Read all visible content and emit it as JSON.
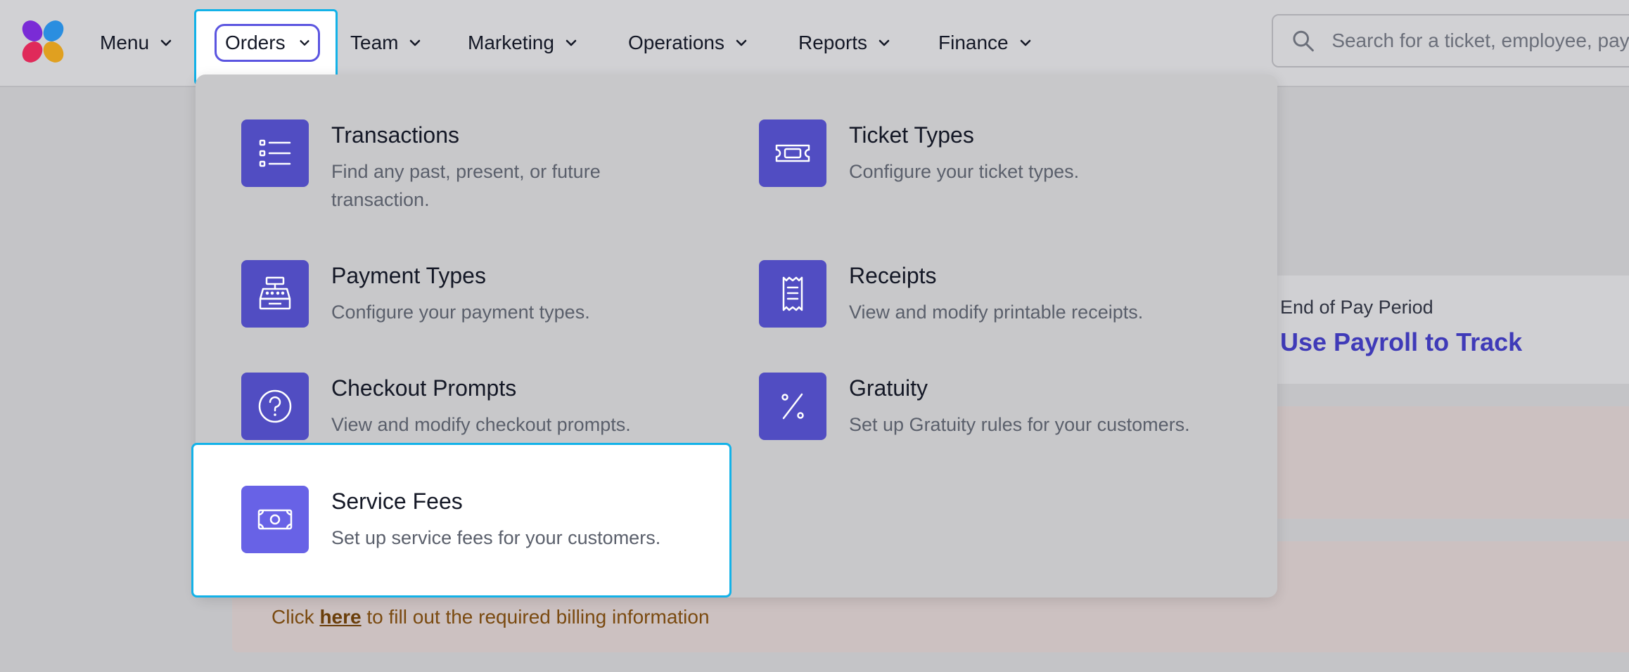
{
  "nav": {
    "items": [
      {
        "label": "Menu"
      },
      {
        "label": "Orders"
      },
      {
        "label": "Team"
      },
      {
        "label": "Marketing"
      },
      {
        "label": "Operations"
      },
      {
        "label": "Reports"
      },
      {
        "label": "Finance"
      }
    ],
    "search_placeholder": "Search for a ticket, employee, pay"
  },
  "dropdown": {
    "items": [
      {
        "title": "Transactions",
        "desc": "Find any past, present, or future transaction.",
        "icon": "list-icon"
      },
      {
        "title": "Ticket Types",
        "desc": "Configure your ticket types.",
        "icon": "ticket-icon"
      },
      {
        "title": "Payment Types",
        "desc": "Configure your payment types.",
        "icon": "cash-register-icon"
      },
      {
        "title": "Receipts",
        "desc": "View and modify printable receipts.",
        "icon": "receipt-icon"
      },
      {
        "title": "Checkout Prompts",
        "desc": "View and modify checkout prompts.",
        "icon": "question-circle-icon"
      },
      {
        "title": "Gratuity",
        "desc": "Set up Gratuity rules for your customers.",
        "icon": "percent-icon"
      },
      {
        "title": "Service Fees",
        "desc": "Set up service fees for your customers.",
        "icon": "banknote-icon"
      }
    ]
  },
  "background": {
    "card_label": "End of Pay Period",
    "card_value": "Use Payroll to Track",
    "alert_prefix": "Click ",
    "alert_link": "here",
    "alert_suffix": " to fill out the required billing information"
  },
  "colors": {
    "accent": "#514dc2",
    "accent_selected": "#6862e6",
    "highlight_border": "#13b2e8",
    "link": "#3f3ab8",
    "alert_text": "#7a4a10"
  }
}
